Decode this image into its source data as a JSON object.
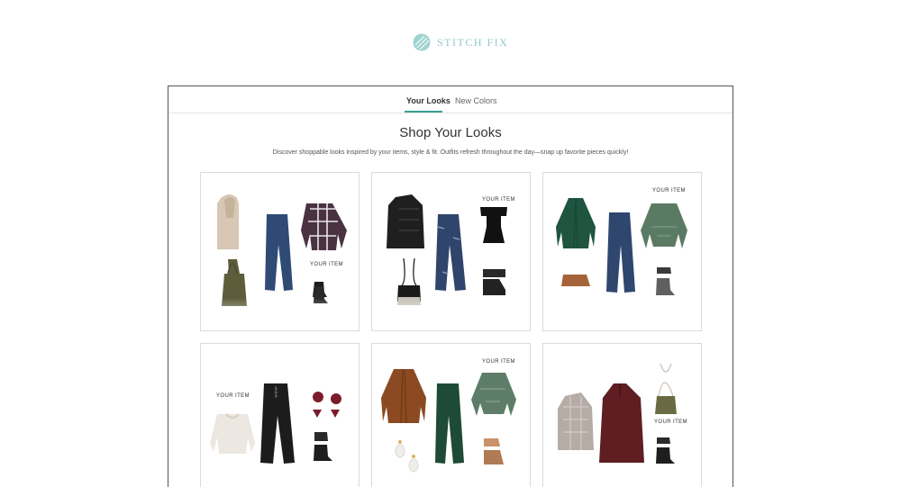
{
  "brand": {
    "name": "STITCH FIX",
    "logo_icon": "stitch-fix-logo-icon",
    "color": "#8fc9c7"
  },
  "tabs": [
    {
      "label": "Your Looks",
      "active": true
    },
    {
      "label": "New Colors",
      "active": false
    }
  ],
  "accent_color": "#3aa198",
  "page_title": "Shop Your Looks",
  "subtitle": "Discover shoppable looks inspired by your items, style & fit. Outfits refresh throughout the day—snap up favorite pieces quickly!",
  "your_item_label": "YOUR ITEM",
  "looks": [
    {
      "items": [
        "sherpa vest",
        "dark skinny jeans",
        "plaid shirt",
        "olive tote bag",
        "black ankle boots"
      ]
    },
    {
      "items": [
        "black quilted jacket",
        "distressed skinny jeans",
        "off-shoulder bodysuit",
        "crossbody bag",
        "black sneakers"
      ]
    },
    {
      "items": [
        "green cardigan",
        "dark skinny jeans",
        "green printed blouse",
        "tan clutch",
        "grey ankle boots"
      ]
    },
    {
      "items": [
        "cream knit sweater",
        "black button-fly jeans",
        "burgundy tassel earrings",
        "black ankle boots"
      ]
    },
    {
      "items": [
        "rust cardigan",
        "green skinny jeans",
        "green printed blouse",
        "drop earrings",
        "tan mules"
      ]
    },
    {
      "items": [
        "patterned cardigan",
        "burgundy dress",
        "olive crossbody bag",
        "black ankle boots"
      ]
    }
  ]
}
